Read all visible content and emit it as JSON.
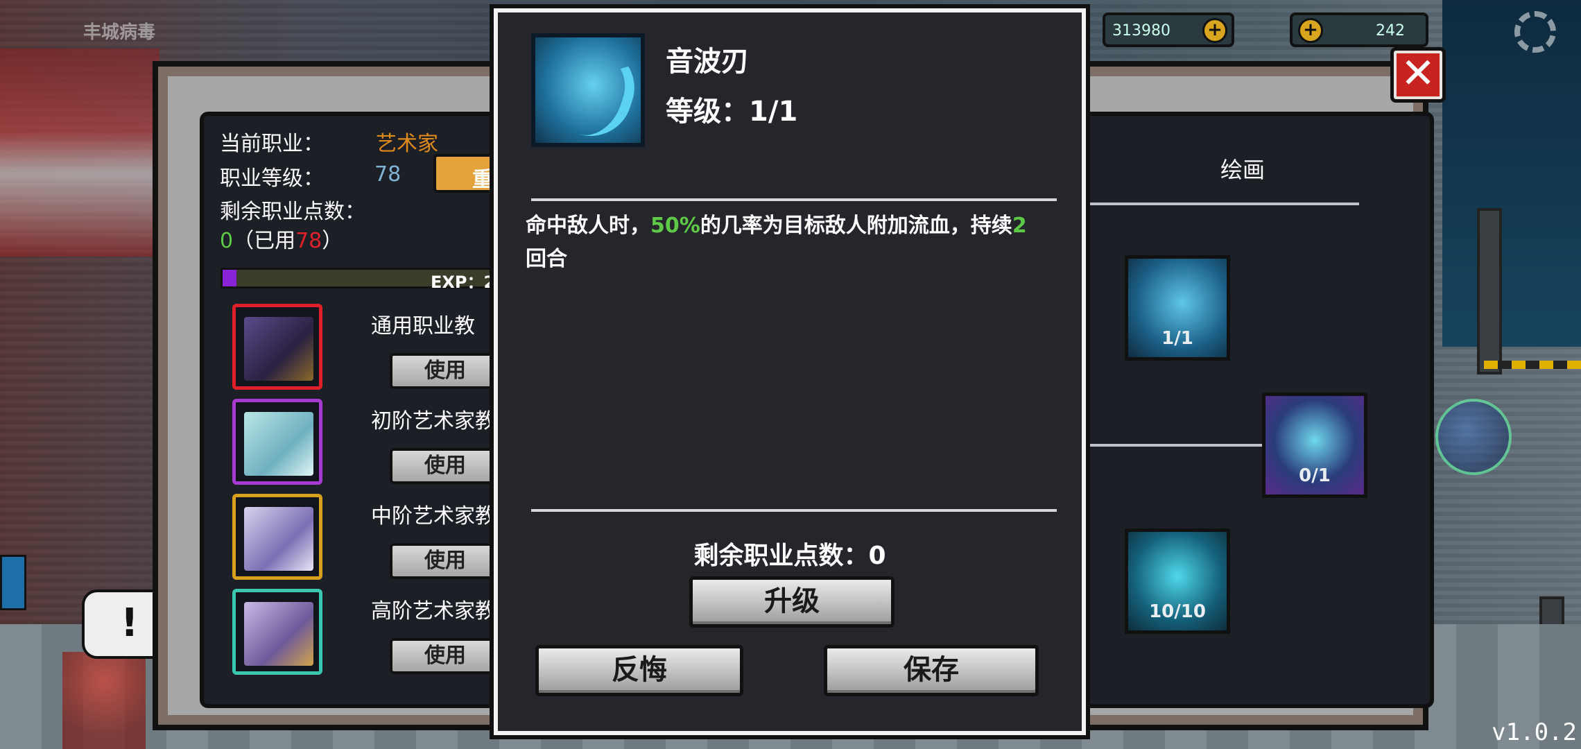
{
  "hud": {
    "title": "丰城病毒",
    "money": "313980",
    "gems": "242",
    "version": "v1.0.2"
  },
  "job_panel": {
    "current_job_label": "当前职业：",
    "current_job_value": "艺术家",
    "job_level_label": "职业等级：",
    "job_level_value": "78",
    "reset_label": "重",
    "remaining_points_label": "剩余职业点数：",
    "remaining_points_value": "0",
    "used_prefix": "（已用",
    "used_value": "78",
    "used_suffix": "）",
    "exp_text": "EXP：2",
    "exp_progress": 0.05
  },
  "books": [
    {
      "name": "通用职业教",
      "use_label": "使用",
      "border": "#e0202a"
    },
    {
      "name": "初阶艺术家教",
      "use_label": "使用",
      "border": "#a63ad1"
    },
    {
      "name": "中阶艺术家教",
      "use_label": "使用",
      "border": "#d8a21e"
    },
    {
      "name": "高阶艺术家教",
      "use_label": "使用",
      "border": "#3cc7b0"
    }
  ],
  "tree": {
    "tab_label": "绘画",
    "nodes": [
      {
        "level": "1/1",
        "icon": "sonic-blade-icon"
      },
      {
        "level": "0/1",
        "icon": "skull-icon"
      },
      {
        "level": "10/10",
        "icon": "undo-arrow-icon"
      }
    ]
  },
  "dialog": {
    "skill_name": "音波刃",
    "skill_level": "等级：1/1",
    "desc_part1": "命中敌人时，",
    "desc_hl1": "50%",
    "desc_part2": "的几率为目标敌人附加流血，持续",
    "desc_hl2": "2",
    "desc_part3": "回合",
    "remaining_points": "剩余职业点数：0",
    "upgrade_label": "升级",
    "undo_label": "反悔",
    "save_label": "保存"
  },
  "colors": {
    "highlight_green": "#5ec946",
    "job_orange": "#e08a1c",
    "close_red": "#c8231e"
  }
}
